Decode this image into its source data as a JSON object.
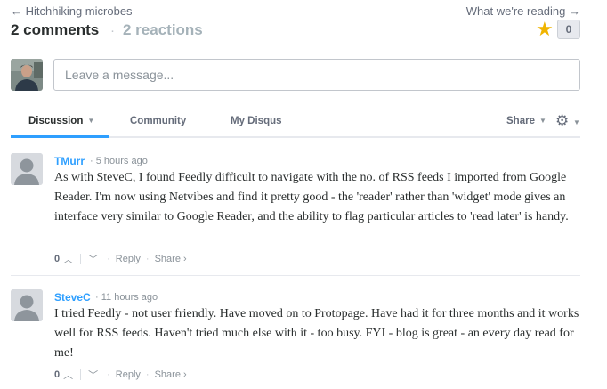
{
  "header": {
    "prev_link": "← Hitchhiking microbes",
    "next_link": "What we're reading →",
    "comments_count": "2 comments",
    "separator": "·",
    "reactions_count": "2 reactions",
    "star_count": "0"
  },
  "composer": {
    "placeholder": "Leave a message..."
  },
  "tabs": {
    "discussion": "Discussion",
    "community": "Community",
    "my_disqus": "My Disqus",
    "share": "Share"
  },
  "comments": [
    {
      "author": "TMurr",
      "time": "5 hours ago",
      "text": "As with SteveC, I found Feedly difficult to navigate with the no. of RSS feeds I imported from Google Reader. I'm now using Netvibes and find it pretty good - the 'reader' rather than 'widget' mode gives an interface very similar to Google Reader, and the ability to flag particular articles to 'read later' is handy.",
      "votes": "0",
      "reply": "Reply",
      "share": "Share ›"
    },
    {
      "author": "SteveC",
      "time": "11 hours ago",
      "text": "I tried Feedly - not user friendly. Have moved on to Protopage. Have had it for three months and it works well for RSS feeds. Haven't tried much else with it - too busy. FYI - blog is great - an every day read for me!",
      "votes": "0",
      "reply": "Reply",
      "share": "Share ›"
    }
  ],
  "colors": {
    "accent": "#2e9fff",
    "star": "#f0b400",
    "muted_text": "#8a9299"
  },
  "icons": {
    "star": "star-icon",
    "gear": "gear-icon",
    "upvote": "chevron-up-icon",
    "downvote": "chevron-down-icon"
  }
}
